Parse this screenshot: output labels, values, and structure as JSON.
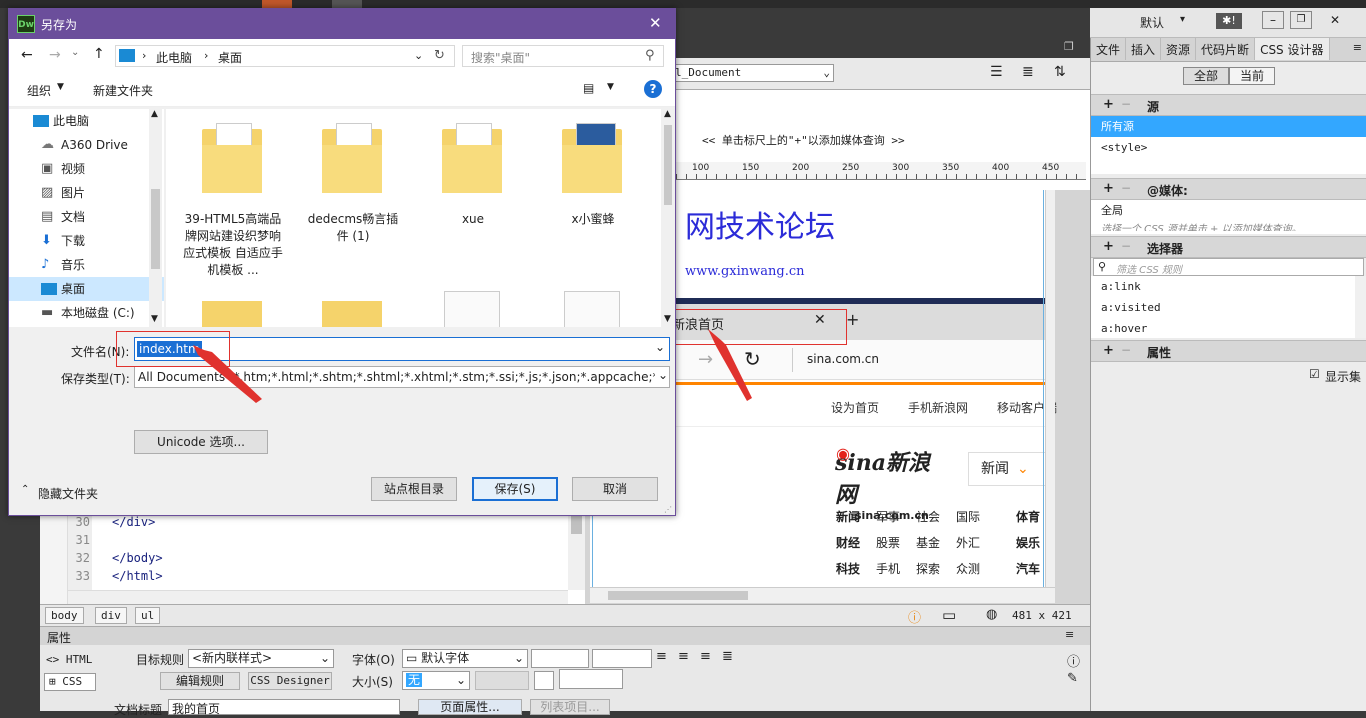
{
  "workspace": {
    "label": "默认",
    "sync_label": "✱!"
  },
  "right_panel": {
    "tabs": [
      "文件",
      "插入",
      "资源",
      "代码片断",
      "CSS 设计器"
    ],
    "toggle_all": "全部",
    "toggle_current": "当前",
    "sources_title": "源",
    "sources": [
      "所有源",
      "<style>"
    ],
    "media_title": "@媒体:",
    "media_global": "全局",
    "media_hint": "选择一个 CSS 源并单击 + 以添加媒体查询。",
    "selectors_title": "选择器",
    "selector_filter_placeholder": "筛选 CSS 规则",
    "selectors": [
      "a:link",
      "a:visited",
      "a:hover"
    ],
    "properties_title": "属性",
    "show_set_label": "显示集"
  },
  "editor": {
    "doc_select": "l_Document",
    "media_hint": "<< 单击标尺上的\"+\"以添加媒体查询 >>",
    "ruler_ticks": [
      "100",
      "150",
      "200",
      "250",
      "300",
      "350",
      "400",
      "450"
    ],
    "page_heading": "网技术论坛",
    "page_url": "www.gxinwang.cn",
    "browser_tab": "新浪首页",
    "address": "sina.com.cn",
    "sina_links": [
      "设为首页",
      "手机新浪网",
      "移动客户端"
    ],
    "sina_logo_text": "sina新浪网",
    "sina_logo_sub": "sina.com.cn",
    "search_select": "新闻",
    "nav_rows": [
      [
        "新闻",
        "军事",
        "社会",
        "国际",
        "体育"
      ],
      [
        "财经",
        "股票",
        "基金",
        "外汇",
        "娱乐"
      ],
      [
        "科技",
        "手机",
        "探索",
        "众测",
        "汽车"
      ]
    ],
    "code_lines": [
      {
        "num": "30",
        "text": "</div>"
      },
      {
        "num": "31",
        "text": ""
      },
      {
        "num": "32",
        "text": "</body>"
      },
      {
        "num": "33",
        "text": "</html>"
      }
    ]
  },
  "status": {
    "tags": [
      "body",
      "div",
      "ul"
    ],
    "size": "481 x 421"
  },
  "properties": {
    "title": "属性",
    "html_btn": "HTML",
    "css_btn": "CSS",
    "target_rule_label": "目标规则",
    "target_rule_value": "<新内联样式>",
    "edit_rule": "编辑规则",
    "css_designer": "CSS Designer",
    "font_label": "字体(O)",
    "font_value": "默认字体",
    "size_label": "大小(S)",
    "size_value": "无",
    "doc_title_label": "文档标题",
    "doc_title_value": "我的首页",
    "page_props": "页面属性...",
    "list_items": "列表项目..."
  },
  "dialog": {
    "app_icon": "Dw",
    "title": "另存为",
    "breadcrumb": [
      "此电脑",
      "桌面"
    ],
    "search_placeholder": "搜索\"桌面\"",
    "organize": "组织",
    "new_folder": "新建文件夹",
    "nav": [
      "此电脑",
      "A360 Drive",
      "视频",
      "图片",
      "文档",
      "下载",
      "音乐",
      "桌面",
      "本地磁盘 (C:)"
    ],
    "files": [
      "39-HTML5高端品牌网站建设织梦响应式模板 自适应手机模板 ...",
      "dedecms畅言插件 (1)",
      "xue",
      "x小蜜蜂"
    ],
    "filename_label": "文件名(N):",
    "filename_value": "index.htm",
    "filetype_label": "保存类型(T):",
    "filetype_value": "All Documents (*.htm;*.html;*.shtm;*.shtml;*.xhtml;*.stm;*.ssi;*.js;*.json;*.appcache;*.xml;*.xs",
    "unicode_btn": "Unicode 选项...",
    "hide_folders": "隐藏文件夹",
    "site_root_btn": "站点根目录",
    "save_btn": "保存(S)",
    "cancel_btn": "取消"
  },
  "colors": {
    "accent": "#6b4e9b",
    "select": "#cce8ff",
    "highlight": "#33a7ff",
    "red": "#e0322e",
    "sina_orange": "#ff8400"
  }
}
